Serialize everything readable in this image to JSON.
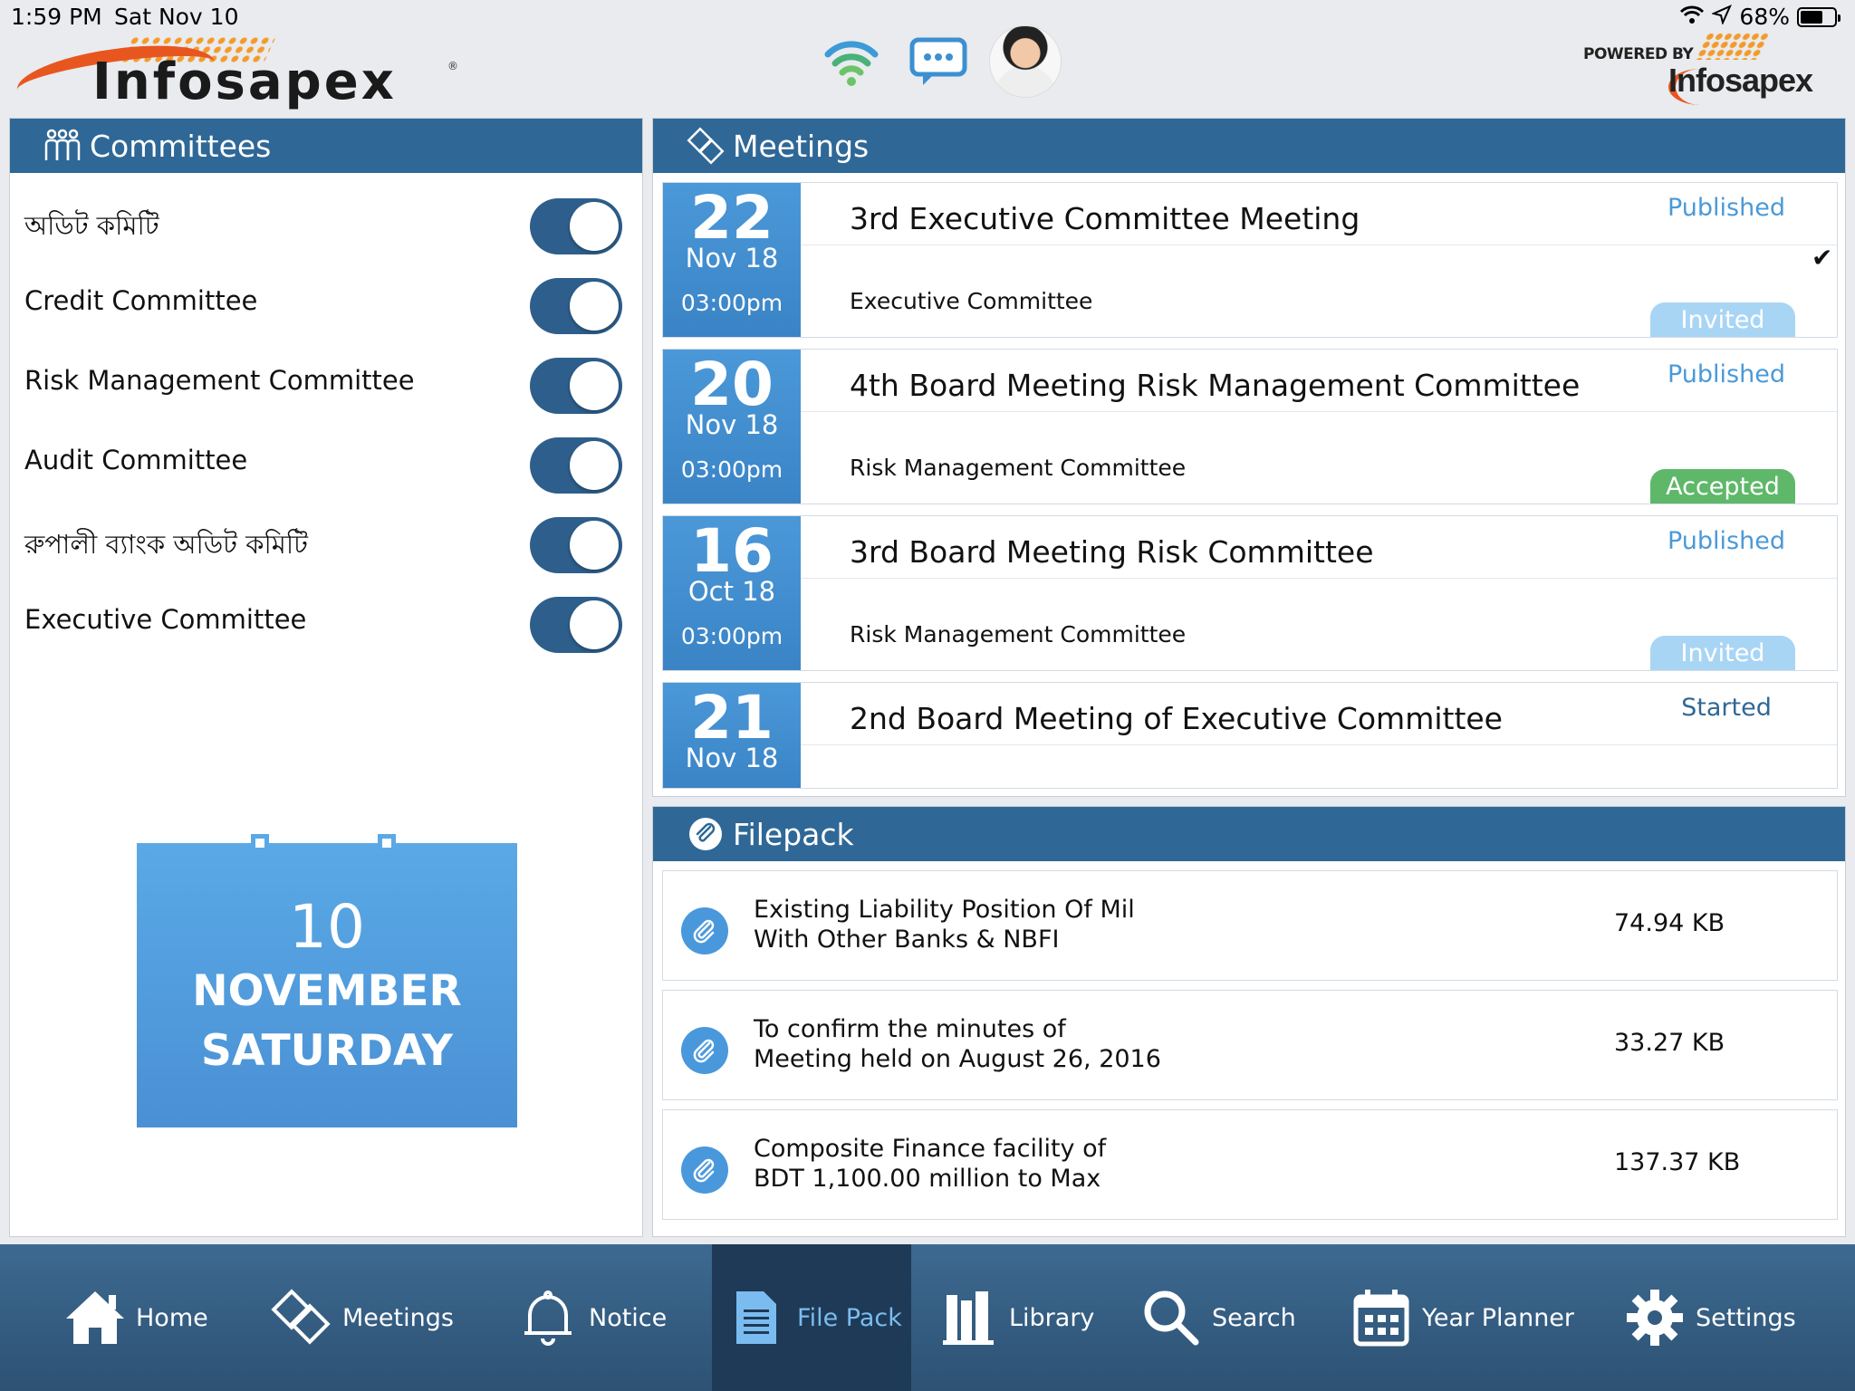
{
  "status_bar": {
    "time": "1:59 PM",
    "date": "Sat Nov 10",
    "battery": "68%",
    "battery_level": 0.68
  },
  "brand": {
    "logo_text": "Infosapex",
    "powered_by": "POWERED BY",
    "powered_logo": "Infosapex"
  },
  "committees": {
    "title": "Committees",
    "items": [
      {
        "label": "অডিট কমিটি",
        "enabled": true
      },
      {
        "label": "Credit Committee",
        "enabled": true
      },
      {
        "label": "Risk Management Committee",
        "enabled": true
      },
      {
        "label": "Audit Committee",
        "enabled": true
      },
      {
        "label": "রুপালী ব্যাংক অডিট কমিটি",
        "enabled": true
      },
      {
        "label": "Executive Committee",
        "enabled": true
      }
    ]
  },
  "calendar": {
    "day": "10",
    "month": "NOVEMBER",
    "weekday": "SATURDAY"
  },
  "meetings": {
    "title": "Meetings",
    "items": [
      {
        "day": "22",
        "month": "Nov 18",
        "time": "03:00pm",
        "title": "3rd Executive Committee Meeting",
        "committee": "Executive Committee",
        "status": "Published",
        "badge": "Invited",
        "checked": true
      },
      {
        "day": "20",
        "month": "Nov 18",
        "time": "03:00pm",
        "title": "4th Board Meeting Risk Management Committee",
        "committee": "Risk Management Committee",
        "status": "Published",
        "badge": "Accepted",
        "checked": false
      },
      {
        "day": "16",
        "month": "Oct 18",
        "time": "03:00pm",
        "title": "3rd Board Meeting Risk Committee",
        "committee": "Risk Management Committee",
        "status": "Published",
        "badge": "Invited",
        "checked": false
      },
      {
        "day": "21",
        "month": "Nov 18",
        "time": "",
        "title": "2nd Board Meeting of Executive Committee",
        "committee": "",
        "status": "Started",
        "badge": "",
        "checked": false
      }
    ]
  },
  "filepack": {
    "title": "Filepack",
    "items": [
      {
        "line1": "Existing Liability Position Of Mil",
        "line2": "With Other Banks & NBFI",
        "size": "74.94 KB"
      },
      {
        "line1": "To confirm the minutes of",
        "line2": "Meeting held on August 26, 2016",
        "size": "33.27 KB"
      },
      {
        "line1": "Composite Finance facility of",
        "line2": "BDT 1,100.00 million to Max",
        "size": "137.37 KB"
      }
    ]
  },
  "tabbar": {
    "active": "File Pack",
    "tabs": [
      {
        "label": "Home",
        "icon": "home-icon"
      },
      {
        "label": "Meetings",
        "icon": "handshake-icon"
      },
      {
        "label": "Notice",
        "icon": "bell-icon"
      },
      {
        "label": "File Pack",
        "icon": "document-icon"
      },
      {
        "label": "Library",
        "icon": "books-icon"
      },
      {
        "label": "Search",
        "icon": "search-icon"
      },
      {
        "label": "Year Planner",
        "icon": "calendar-icon"
      },
      {
        "label": "Settings",
        "icon": "gear-icon"
      }
    ]
  },
  "colors": {
    "header_blue": "#2f6896",
    "date_blue": "#4b98d8",
    "status_blue": "#4a9ad8",
    "accepted_green": "#5fb86a",
    "invited_light": "#a9d5f5",
    "toggle_on": "#2e5f8c",
    "brand_orange": "#e8561f"
  }
}
